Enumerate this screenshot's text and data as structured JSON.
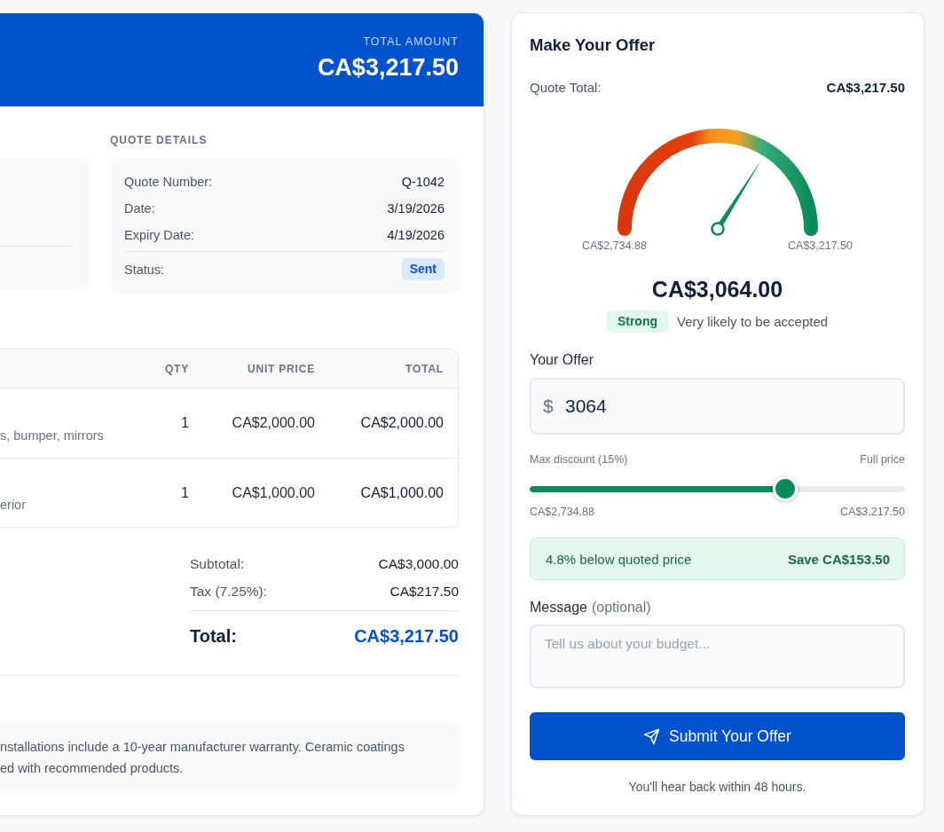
{
  "quote_card": {
    "header": {
      "label": "TOTAL AMOUNT",
      "amount": "CA$3,217.50"
    },
    "details": {
      "title": "QUOTE DETAILS",
      "rows": [
        {
          "kind": "text",
          "label": "Quote Number:",
          "value": "Q-1042"
        },
        {
          "kind": "text",
          "label": "Date:",
          "value": "3/19/2026"
        },
        {
          "kind": "text",
          "label": "Expiry Date:",
          "value": "4/19/2026"
        },
        {
          "kind": "badge",
          "label": "Status:",
          "value": "Sent"
        }
      ]
    },
    "table": {
      "columns": [
        "QTY",
        "UNIT PRICE",
        "TOTAL"
      ],
      "rows": [
        {
          "detail": "s, bumper, mirrors",
          "qty": "1",
          "unit_price": "CA$2,000.00",
          "total": "CA$2,000.00"
        },
        {
          "detail": "erior",
          "qty": "1",
          "unit_price": "CA$1,000.00",
          "total": "CA$1,000.00"
        }
      ]
    },
    "totals": [
      {
        "kind": "line",
        "label": "Subtotal:",
        "value": "CA$3,000.00"
      },
      {
        "kind": "line",
        "label": "Tax (7.25%):",
        "value": "CA$217.50"
      },
      {
        "kind": "grand",
        "label": "Total:",
        "value": "CA$3,217.50"
      }
    ],
    "notes": {
      "lines": [
        "nstallations include a 10-year manufacturer warranty. Ceramic coatings",
        "ed with recommended products."
      ]
    }
  },
  "offer_panel": {
    "title": "Make Your Offer",
    "quote_total": {
      "label": "Quote Total:",
      "value": "CA$3,217.50"
    },
    "gauge": {
      "level": 0.68,
      "min_label": "CA$2,734.88",
      "max_label": "CA$3,217.50",
      "value": "CA$3,064.00",
      "rating": "Strong",
      "rating_text": "Very likely to be accepted"
    },
    "offer_field": {
      "label": "Your Offer",
      "prefix": "$",
      "value": "3064"
    },
    "slider": {
      "left_caption": "Max discount (15%)",
      "right_caption": "Full price",
      "level": 0.68,
      "min_label": "CA$2,734.88",
      "max_label": "CA$3,217.50"
    },
    "savings": {
      "text": "4.8% below quoted price",
      "amount": "Save CA$153.50"
    },
    "message": {
      "label": "Message",
      "hint": "(optional)",
      "placeholder": "Tell us about your budget..."
    },
    "submit": {
      "label": "Submit Your Offer"
    },
    "footnote": "You'll hear back within 48 hours."
  }
}
